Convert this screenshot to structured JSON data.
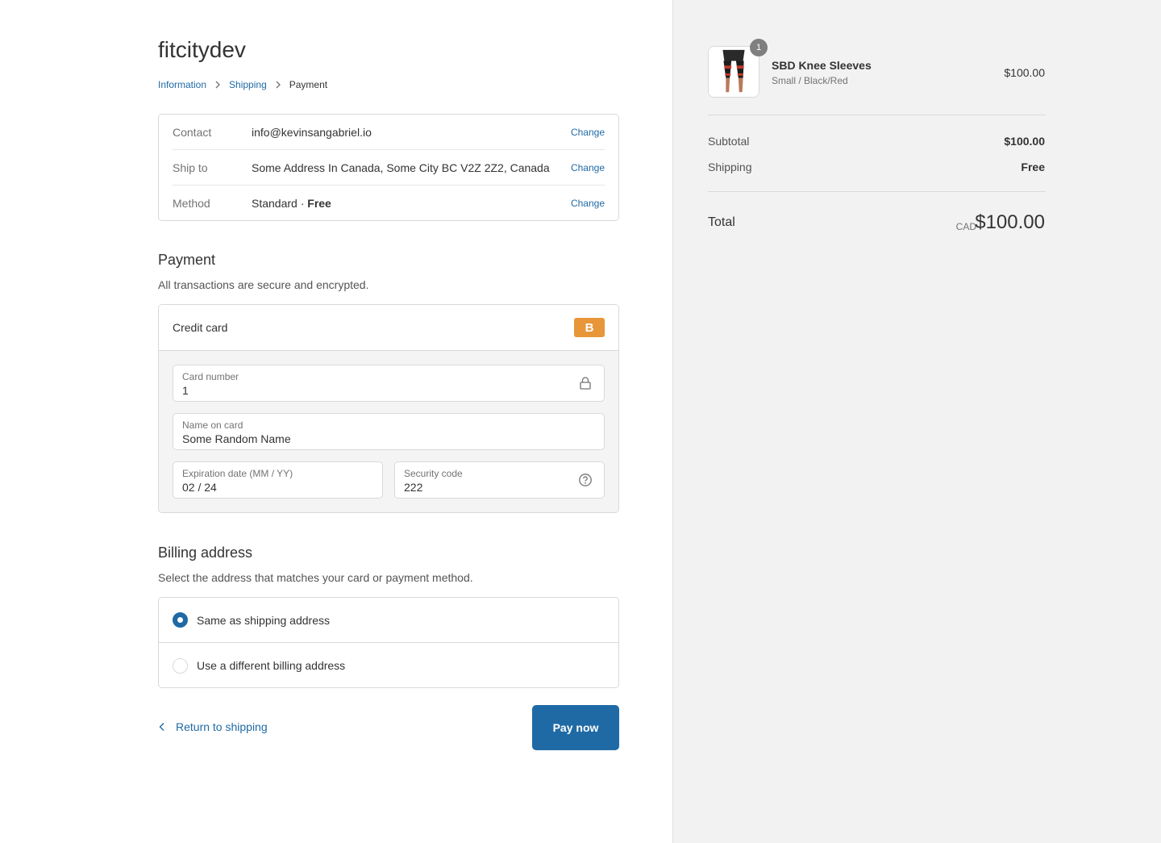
{
  "shop": {
    "name": "fitcitydev"
  },
  "breadcrumb": {
    "items": [
      {
        "label": "Information"
      },
      {
        "label": "Shipping"
      },
      {
        "label": "Payment"
      }
    ]
  },
  "review": {
    "contact": {
      "label": "Contact",
      "value": "info@kevinsangabriel.io",
      "action": "Change"
    },
    "ship_to": {
      "label": "Ship to",
      "value": "Some Address In Canada, Some City BC V2Z 2Z2, Canada",
      "action": "Change"
    },
    "method": {
      "label": "Method",
      "value_prefix": "Standard · ",
      "value_bold": "Free",
      "action": "Change"
    }
  },
  "payment": {
    "title": "Payment",
    "subtitle": "All transactions are secure and encrypted.",
    "method_label": "Credit card",
    "gateway_badge": "B",
    "gateway_color": "#e8963a",
    "fields": {
      "card_number": {
        "label": "Card number",
        "value": "1",
        "icon": "lock-icon"
      },
      "name_on_card": {
        "label": "Name on card",
        "value": "Some Random Name"
      },
      "expiration": {
        "label": "Expiration date (MM / YY)",
        "value": "02 / 24"
      },
      "security_code": {
        "label": "Security code",
        "value": "222",
        "icon": "question-circle-icon"
      }
    }
  },
  "billing": {
    "title": "Billing address",
    "subtitle": "Select the address that matches your card or payment method.",
    "options": [
      {
        "label": "Same as shipping address",
        "selected": true
      },
      {
        "label": "Use a different billing address",
        "selected": false
      }
    ]
  },
  "actions": {
    "return_label": "Return to shipping",
    "pay_label": "Pay now",
    "accent_color": "#1f6aa5"
  },
  "order": {
    "item": {
      "name": "SBD Knee Sleeves",
      "variant": "Small / Black/Red",
      "price": "$100.00",
      "quantity": "1"
    },
    "subtotal": {
      "label": "Subtotal",
      "value": "$100.00"
    },
    "shipping": {
      "label": "Shipping",
      "value": "Free"
    },
    "total": {
      "label": "Total",
      "currency": "CAD",
      "value": "$100.00"
    }
  }
}
